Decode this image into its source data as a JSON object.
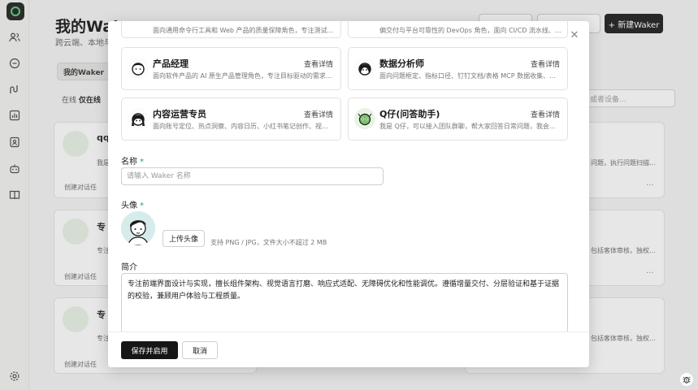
{
  "app": {
    "page_title": "我的Waker",
    "page_subtitle": "跨云端、本地与",
    "header_buttons": {
      "new_waker": "+ 新建Waker"
    },
    "tab_active": "我的Waker",
    "filter": {
      "label": "在线",
      "value": "仅在线",
      "search_placeholder": "或者设备..."
    },
    "bg_cards": [
      {
        "title": "qq",
        "snippet": "我是",
        "action": "创建对话任"
      },
      {
        "title": "专",
        "snippet": "专注",
        "action": "创建对话任"
      },
      {
        "title": "专",
        "snippet": "专注",
        "action": "创建对话任"
      }
    ],
    "bg_right_snippets": [
      "问题，执行问题扫描...",
      "包括客体审核，独权...",
      "包括客体审核，独权..."
    ]
  },
  "modal": {
    "top_partial_cards": [
      {
        "desc": "面向通用命令行工具和 Web 产品的质量保障角色，专注测试..."
      },
      {
        "desc": "偏交付与平台可靠性的 DevOps 角色，面向 CI/CD 流水线、..."
      }
    ],
    "role_cards": [
      {
        "title": "产品经理",
        "link": "查看详情",
        "desc": "面向软件产品的 AI 原生产品管理角色，专注目标驱动的需求..."
      },
      {
        "title": "数据分析师",
        "link": "查看详情",
        "desc": "面向问题框定、指标口径、钉钉文档/表格 MCP 数据收集、..."
      },
      {
        "title": "内容运营专员",
        "link": "查看详情",
        "desc": "面向账号定位、热点洞察、内容日历、小红书笔记创作、视..."
      },
      {
        "title": "Q仔(问答助手)",
        "link": "查看详情",
        "desc": "我是 Q仔，可以接入团队群聊，帮大家回答日常问题，我会..."
      }
    ],
    "name": {
      "label": "名称",
      "required": "*",
      "placeholder": "请输入 Waker 名称",
      "value": ""
    },
    "avatar": {
      "label": "头像",
      "required": "*",
      "upload_label": "上传头像",
      "hint": "支持 PNG / JPG，文件大小不超过 2 MB"
    },
    "intro": {
      "label": "简介",
      "value": "专注前端界面设计与实现，擅长组件架构、视觉语言打磨、响应式适配、无障碍优化和性能调优。遵循增量交付、分层验证和基于证据的校验，兼顾用户体验与工程质量。"
    },
    "footer": {
      "save_label": "保存并启用",
      "cancel_label": "取消"
    },
    "close_icon": "close-icon"
  },
  "colors": {
    "accent": "#2ea44f",
    "primary_button": "#161616"
  }
}
